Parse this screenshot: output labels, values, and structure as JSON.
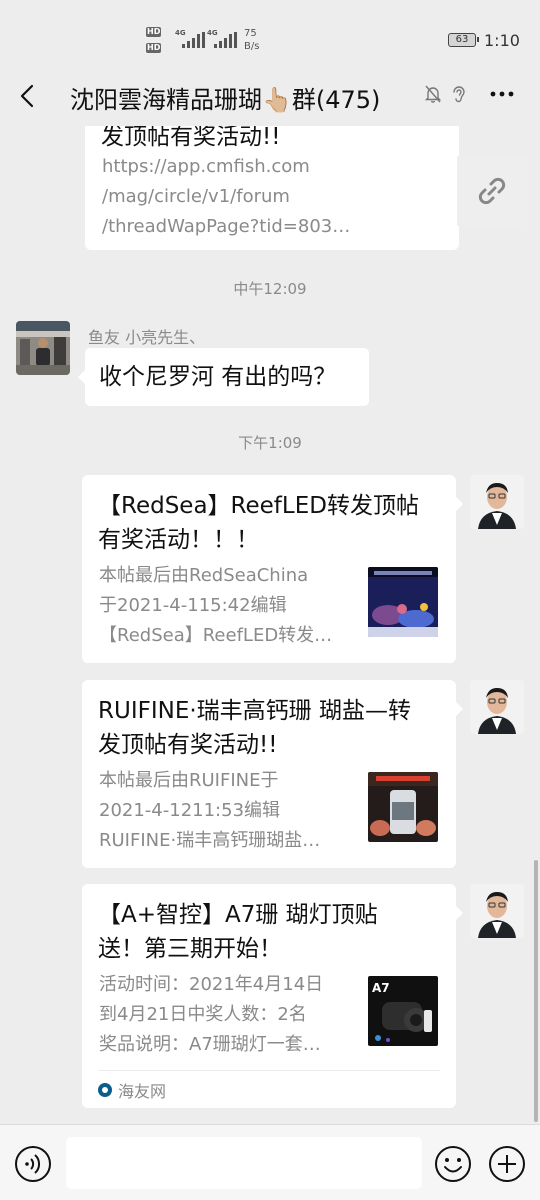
{
  "status_bar": {
    "hd1": "HD",
    "hd2": "HD",
    "net1": "4G",
    "net2": "4G",
    "speed_value": "75",
    "speed_unit": "B/s",
    "battery": "63",
    "time": "1:10"
  },
  "header": {
    "title": "沈阳雲海精品珊瑚👆🏼群(475)"
  },
  "messages": {
    "card1": {
      "title": "发顶帖有奖活动!!",
      "desc_lines": [
        "https://app.cmfish.com",
        "/mag/circle/v1/forum",
        "/threadWapPage?tid=803…"
      ]
    },
    "time1": "中午12:09",
    "msg2": {
      "sender": "鱼友 小亮先生、",
      "text": "收个尼罗河 有出的吗？"
    },
    "time2": "下午1:09",
    "card3": {
      "title_lines": [
        "【RedSea】ReefLED转发顶帖",
        "有奖活动！！！"
      ],
      "desc_lines": [
        "本帖最后由RedSeaChina",
        "于2021-4-115:42编辑",
        "【RedSea】ReefLED转发…"
      ]
    },
    "card4": {
      "title_lines": [
        "RUIFINE·瑞丰高钙珊 瑚盐—转",
        "发顶帖有奖活动!!"
      ],
      "desc_lines": [
        "本帖最后由RUIFINE于",
        "2021-4-1211:53编辑",
        "RUIFINE·瑞丰高钙珊瑚盐…"
      ]
    },
    "card5": {
      "title_lines": [
        "【A+智控】A7珊 瑚灯顶贴",
        "送！第三期开始！"
      ],
      "desc_lines": [
        "活动时间：2021年4月14日",
        "到4月21日中奖人数：2名",
        "奖品说明：A7珊瑚灯一套…"
      ],
      "thumb_label": "A7",
      "source": "海友网"
    }
  },
  "colors": {
    "background": "#ededed",
    "bubble": "#ffffff",
    "muted_text": "#8a8a8a"
  }
}
